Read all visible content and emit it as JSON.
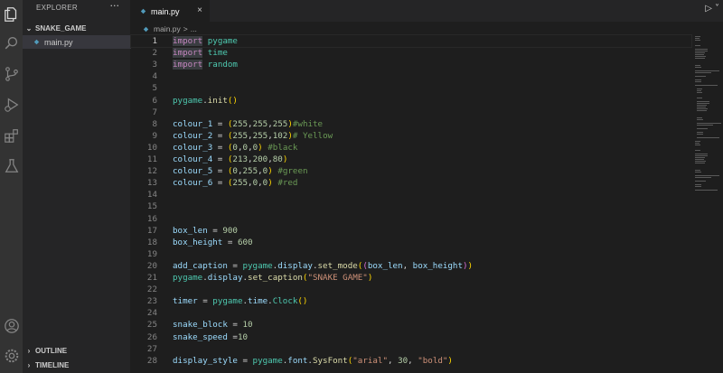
{
  "sidebar": {
    "title": "EXPLORER",
    "more": "···",
    "folder": "SNAKE_GAME",
    "file": "main.py",
    "outline": "OUTLINE",
    "timeline": "TIMELINE"
  },
  "tab": {
    "label": "main.py",
    "close": "×"
  },
  "breadcrumb": {
    "file": "main.py",
    "sep": ">",
    "rest": "..."
  },
  "run": {
    "play": "▷",
    "dropdown": "˅"
  },
  "colors": {
    "keyword": "#c586c0",
    "module": "#4ec9b0",
    "variable": "#9cdcfe",
    "function": "#dcdcaa",
    "number": "#b5cea8",
    "string": "#ce9178",
    "comment": "#6a9955"
  },
  "activity": [
    "explorer-icon",
    "search-icon",
    "source-control-icon",
    "run-debug-icon",
    "extensions-icon",
    "testing-icon",
    "account-icon",
    "settings-gear-icon"
  ],
  "code": {
    "active_line": 1,
    "lines": [
      {
        "n": "1",
        "tokens": [
          [
            "kw",
            "import"
          ],
          [
            "op",
            " "
          ],
          [
            "mod",
            "pygame"
          ]
        ]
      },
      {
        "n": "2",
        "tokens": [
          [
            "kw",
            "import"
          ],
          [
            "op",
            " "
          ],
          [
            "mod",
            "time"
          ]
        ]
      },
      {
        "n": "3",
        "tokens": [
          [
            "kw",
            "import"
          ],
          [
            "op",
            " "
          ],
          [
            "mod",
            "random"
          ]
        ]
      },
      {
        "n": "4",
        "tokens": []
      },
      {
        "n": "5",
        "tokens": []
      },
      {
        "n": "6",
        "tokens": [
          [
            "mod",
            "pygame"
          ],
          [
            "op",
            "."
          ],
          [
            "fn",
            "init"
          ],
          [
            "p1",
            "()"
          ]
        ]
      },
      {
        "n": "7",
        "tokens": []
      },
      {
        "n": "8",
        "tokens": [
          [
            "var",
            "colour_1"
          ],
          [
            "op",
            " = "
          ],
          [
            "p1",
            "("
          ],
          [
            "num",
            "255"
          ],
          [
            "op",
            ","
          ],
          [
            "num",
            "255"
          ],
          [
            "op",
            ","
          ],
          [
            "num",
            "255"
          ],
          [
            "p1",
            ")"
          ],
          [
            "cmt",
            "#white"
          ]
        ]
      },
      {
        "n": "9",
        "tokens": [
          [
            "var",
            "colour_2"
          ],
          [
            "op",
            " = "
          ],
          [
            "p1",
            "("
          ],
          [
            "num",
            "255"
          ],
          [
            "op",
            ","
          ],
          [
            "num",
            "255"
          ],
          [
            "op",
            ","
          ],
          [
            "num",
            "102"
          ],
          [
            "p1",
            ")"
          ],
          [
            "cmt",
            "# Yellow"
          ]
        ]
      },
      {
        "n": "10",
        "tokens": [
          [
            "var",
            "colour_3"
          ],
          [
            "op",
            " = "
          ],
          [
            "p1",
            "("
          ],
          [
            "num",
            "0"
          ],
          [
            "op",
            ","
          ],
          [
            "num",
            "0"
          ],
          [
            "op",
            ","
          ],
          [
            "num",
            "0"
          ],
          [
            "p1",
            ")"
          ],
          [
            "op",
            " "
          ],
          [
            "cmt",
            "#black"
          ]
        ]
      },
      {
        "n": "11",
        "tokens": [
          [
            "var",
            "colour_4"
          ],
          [
            "op",
            " = "
          ],
          [
            "p1",
            "("
          ],
          [
            "num",
            "213"
          ],
          [
            "op",
            ","
          ],
          [
            "num",
            "200"
          ],
          [
            "op",
            ","
          ],
          [
            "num",
            "80"
          ],
          [
            "p1",
            ")"
          ]
        ]
      },
      {
        "n": "12",
        "tokens": [
          [
            "var",
            "colour_5"
          ],
          [
            "op",
            " = "
          ],
          [
            "p1",
            "("
          ],
          [
            "num",
            "0"
          ],
          [
            "op",
            ","
          ],
          [
            "num",
            "255"
          ],
          [
            "op",
            ","
          ],
          [
            "num",
            "0"
          ],
          [
            "p1",
            ")"
          ],
          [
            "op",
            " "
          ],
          [
            "cmt",
            "#green"
          ]
        ]
      },
      {
        "n": "13",
        "tokens": [
          [
            "var",
            "colour_6"
          ],
          [
            "op",
            " = "
          ],
          [
            "p1",
            "("
          ],
          [
            "num",
            "255"
          ],
          [
            "op",
            ","
          ],
          [
            "num",
            "0"
          ],
          [
            "op",
            ","
          ],
          [
            "num",
            "0"
          ],
          [
            "p1",
            ")"
          ],
          [
            "op",
            " "
          ],
          [
            "cmt",
            "#red"
          ]
        ]
      },
      {
        "n": "14",
        "tokens": []
      },
      {
        "n": "15",
        "tokens": []
      },
      {
        "n": "16",
        "tokens": []
      },
      {
        "n": "17",
        "tokens": [
          [
            "var",
            "box_len"
          ],
          [
            "op",
            " = "
          ],
          [
            "num",
            "900"
          ]
        ]
      },
      {
        "n": "18",
        "tokens": [
          [
            "var",
            "box_height"
          ],
          [
            "op",
            " = "
          ],
          [
            "num",
            "600"
          ]
        ]
      },
      {
        "n": "19",
        "tokens": []
      },
      {
        "n": "20",
        "tokens": [
          [
            "var",
            "add_caption"
          ],
          [
            "op",
            " = "
          ],
          [
            "mod",
            "pygame"
          ],
          [
            "op",
            "."
          ],
          [
            "var",
            "display"
          ],
          [
            "op",
            "."
          ],
          [
            "fn",
            "set_mode"
          ],
          [
            "p1",
            "("
          ],
          [
            "p2",
            "("
          ],
          [
            "var",
            "box_len"
          ],
          [
            "op",
            ", "
          ],
          [
            "var",
            "box_height"
          ],
          [
            "p2",
            ")"
          ],
          [
            "p1",
            ")"
          ]
        ]
      },
      {
        "n": "21",
        "tokens": [
          [
            "mod",
            "pygame"
          ],
          [
            "op",
            "."
          ],
          [
            "var",
            "display"
          ],
          [
            "op",
            "."
          ],
          [
            "fn",
            "set_caption"
          ],
          [
            "p1",
            "("
          ],
          [
            "str",
            "\"SNAKE GAME\""
          ],
          [
            "p1",
            ")"
          ]
        ]
      },
      {
        "n": "22",
        "tokens": []
      },
      {
        "n": "23",
        "tokens": [
          [
            "var",
            "timer"
          ],
          [
            "op",
            " = "
          ],
          [
            "mod",
            "pygame"
          ],
          [
            "op",
            "."
          ],
          [
            "var",
            "time"
          ],
          [
            "op",
            "."
          ],
          [
            "mod",
            "Clock"
          ],
          [
            "p1",
            "()"
          ]
        ]
      },
      {
        "n": "24",
        "tokens": []
      },
      {
        "n": "25",
        "tokens": [
          [
            "var",
            "snake_block"
          ],
          [
            "op",
            " = "
          ],
          [
            "num",
            "10"
          ]
        ]
      },
      {
        "n": "26",
        "tokens": [
          [
            "var",
            "snake_speed"
          ],
          [
            "op",
            " ="
          ],
          [
            "num",
            "10"
          ]
        ]
      },
      {
        "n": "27",
        "tokens": []
      },
      {
        "n": "28",
        "tokens": [
          [
            "var",
            "display_style"
          ],
          [
            "op",
            " = "
          ],
          [
            "mod",
            "pygame"
          ],
          [
            "op",
            "."
          ],
          [
            "var",
            "font"
          ],
          [
            "op",
            "."
          ],
          [
            "fn",
            "SysFont"
          ],
          [
            "p1",
            "("
          ],
          [
            "str",
            "\"arial\""
          ],
          [
            "op",
            ", "
          ],
          [
            "num",
            "30"
          ],
          [
            "op",
            ", "
          ],
          [
            "str",
            "\"bold\""
          ],
          [
            "p1",
            ")"
          ]
        ]
      }
    ]
  }
}
